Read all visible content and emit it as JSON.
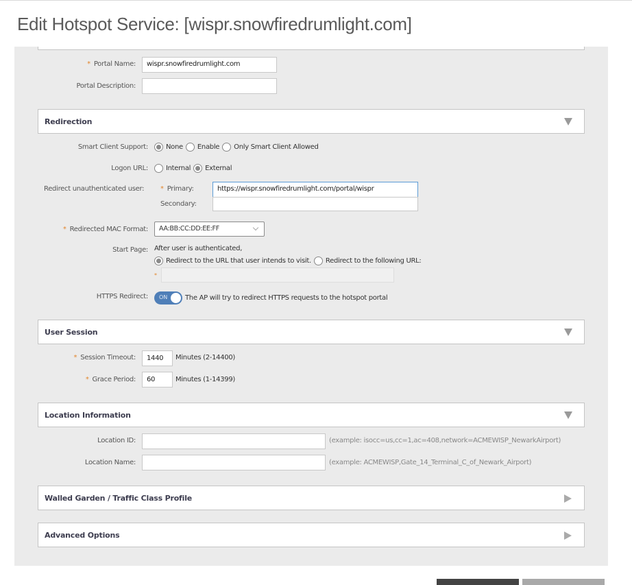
{
  "page": {
    "title": "Edit Hotspot Service: [wispr.snowfiredrumlight.com]"
  },
  "portal": {
    "name_label": "Portal Name:",
    "name_value": "wispr.snowfiredrumlight.com",
    "name_required": true,
    "description_label": "Portal Description:",
    "description_value": ""
  },
  "required_marker": "*",
  "sections": {
    "redirection": {
      "title": "Redirection",
      "expanded": true
    },
    "user_session": {
      "title": "User Session",
      "expanded": true
    },
    "location_information": {
      "title": "Location Information",
      "expanded": true
    },
    "walled_garden": {
      "title": "Walled Garden / Traffic Class Profile",
      "expanded": false
    },
    "advanced_options": {
      "title": "Advanced Options",
      "expanded": false
    }
  },
  "redirection": {
    "smart_client": {
      "label": "Smart Client Support:",
      "options": [
        {
          "label": "None",
          "checked": true
        },
        {
          "label": "Enable",
          "checked": false
        },
        {
          "label": "Only Smart Client Allowed",
          "checked": false
        }
      ]
    },
    "logon_url": {
      "label": "Logon URL:",
      "options": [
        {
          "label": "Internal",
          "checked": false
        },
        {
          "label": "External",
          "checked": true
        }
      ]
    },
    "redirect_unauth": {
      "label": "Redirect unauthenticated user:",
      "primary_label": "Primary:",
      "primary_value": "https://wispr.snowfiredrumlight.com/portal/wispr",
      "secondary_label": "Secondary:",
      "secondary_value": ""
    },
    "mac_format": {
      "label": "Redirected MAC Format:",
      "selected": "AA:BB:CC:DD:EE:FF"
    },
    "start_page": {
      "label": "Start Page:",
      "intro": "After user is authenticated,",
      "options": [
        {
          "label": "Redirect to the URL that user intends to visit.",
          "checked": true
        },
        {
          "label": "Redirect to the following URL:",
          "checked": false
        }
      ],
      "url_value": ""
    },
    "https_redirect": {
      "label": "HTTPS Redirect:",
      "toggle_state": "ON",
      "description": "The AP will try to redirect HTTPS requests to the hotspot portal"
    }
  },
  "user_session": {
    "session_timeout": {
      "label": "Session Timeout:",
      "value": "1440",
      "unit_hint": "Minutes (2-14400)"
    },
    "grace_period": {
      "label": "Grace Period:",
      "value": "60",
      "unit_hint": "Minutes (1-14399)"
    }
  },
  "location": {
    "location_id": {
      "label": "Location ID:",
      "value": "",
      "example": "(example: isocc=us,cc=1,ac=408,network=ACMEWISP_NewarkAirport)"
    },
    "location_name": {
      "label": "Location Name:",
      "value": "",
      "example": "(example: ACMEWISP,Gate_14_Terminal_C_of_Newark_Airport)"
    }
  },
  "footer": {
    "primary_button": "",
    "secondary_button": ""
  }
}
